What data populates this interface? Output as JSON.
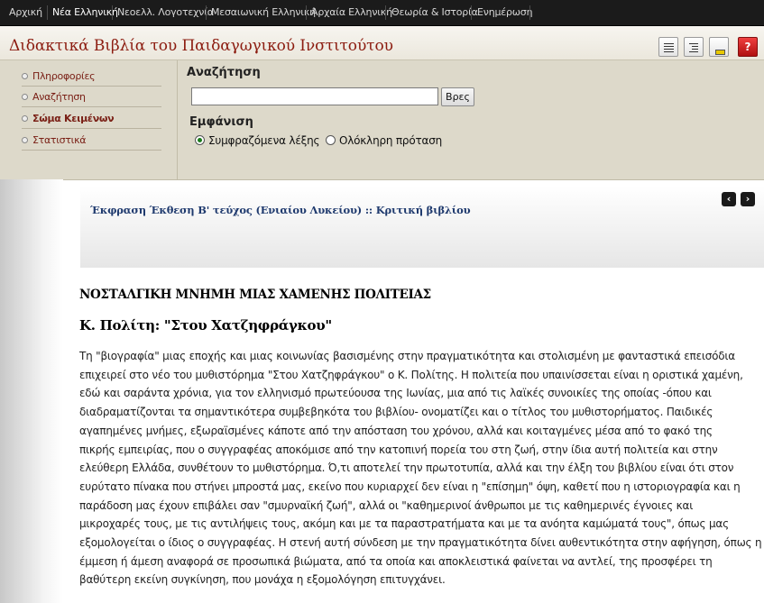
{
  "nav": {
    "items": [
      "Αρχική",
      "Νέα Ελληνική",
      "Νεοελλ. Λογοτεχνία",
      "Μεσαιωνική Ελληνική",
      "Αρχαία Ελληνική",
      "Θεωρία & Ιστορία",
      "Ενημέρωση"
    ],
    "active_index": 1
  },
  "header": {
    "title": "Διδακτικά Βιβλία του Παιδαγωγικού Ινστιτούτου",
    "help_glyph": "?"
  },
  "sidebar": {
    "items": [
      {
        "label": "Πληροφορίες"
      },
      {
        "label": "Αναζήτηση"
      },
      {
        "label": "Σώμα Κειμένων"
      },
      {
        "label": "Στατιστικά"
      }
    ],
    "active_index": 2
  },
  "search": {
    "label": "Αναζήτηση",
    "input_value": "",
    "button_label": "Βρες",
    "display_label": "Εμφάνιση",
    "options": [
      "Συμφραζόμενα λέξης",
      "Ολόκληρη πρόταση"
    ],
    "selected_index": 0
  },
  "breadcrumb": {
    "book": "Έκφραση Έκθεση Β' τεύχος (Ενιαίου Λυκείου)",
    "separator": "::",
    "section": "Κριτική βιβλίου",
    "prev_glyph": "‹",
    "next_glyph": "›"
  },
  "article": {
    "heading": "ΝΟΣΤΑΛΓΙΚΗ ΜΝΗΜΗ ΜΙΑΣ ΧΑΜΕΝΗΣ ΠΟΛΙΤΕΙΑΣ",
    "subheading": "Κ. Πολίτη: \"Στου Χατζηφράγκου\"",
    "lines": [
      "Τη \"βιογραφία\" μιας εποχής και μιας κοινωνίας βασισμένης στην πραγματικότητα και στολισμένη με φανταστικά επεισόδια",
      "επιχειρεί στο νέο του μυθιστόρημα \"Στου Χατζηφράγκου\" ο Κ. Πολίτης. Η πολιτεία που υπαινίσσεται είναι η οριστικά χαμένη,",
      "εδώ και σαράντα χρόνια, για τον ελληνισμό πρωτεύουσα της Ιωνίας, μια από τις λαϊκές συνοικίες της οποίας -όπου και",
      "διαδραματίζονται τα σημαντικότερα συμβεβηκότα του βιβλίου- ονοματίζει και ο τίτλος του μυθιστορήματος. Παιδικές",
      "αγαπημένες μνήμες, εξωραϊσμένες κάποτε από την απόσταση του χρόνου, αλλά και κοιταγμένες μέσα από το φακό της",
      "πικρής εμπειρίας, που ο συγγραφέας αποκόμισε από την κατοπινή πορεία του στη ζωή, στην ίδια αυτή πολιτεία και στην",
      "ελεύθερη Ελλάδα, συνθέτουν το μυθιστόρημα. Ό,τι αποτελεί την πρωτοτυπία, αλλά και την έλξη του βιβλίου είναι ότι στον",
      "ευρύτατο πίνακα που στήνει μπροστά μας, εκείνο που κυριαρχεί δεν είναι η \"επίσημη\" όψη, καθετί που η ιστοριογραφία και η",
      "παράδοση μας έχουν επιβάλει σαν \"σμυρναϊκή ζωή\", αλλά οι \"καθημερινοί άνθρωποι με τις καθημερινές έγνοιες και",
      "μικροχαρές τους, με τις αντιλήψεις τους, ακόμη και με τα παραστρατήματα και με τα ανόητα καμώματά τους\", όπως μας",
      "εξομολογείται ο ίδιος ο συγγραφέας. Η στενή αυτή σύνδεση με την πραγματικότητα δίνει αυθεντικότητα στην αφήγηση, όπως η",
      "έμμεση ή άμεση αναφορά σε προσωπικά βιώματα, από τα οποία και αποκλειστικά φαίνεται να αντλεί, της προσφέρει τη",
      "βαθύτερη εκείνη συγκίνηση, που μονάχα η εξομολόγηση επιτυγχάνει."
    ]
  },
  "icons": {
    "toolbar": [
      "layout-list-icon",
      "layout-outline-icon",
      "minimize-icon",
      "help-icon"
    ],
    "sidebar_bullet": "circle-bullet-icon",
    "nav_arrows": [
      "prev-arrow-icon",
      "next-arrow-icon"
    ]
  },
  "colors": {
    "nav_bg": "#1b1b1b",
    "title": "#8c1c10",
    "panel_bg": "#ddd9ca",
    "sidebar_link": "#7a2016",
    "breadcrumb": "#1f3a6e",
    "radio_selected": "#1a7a1a"
  }
}
